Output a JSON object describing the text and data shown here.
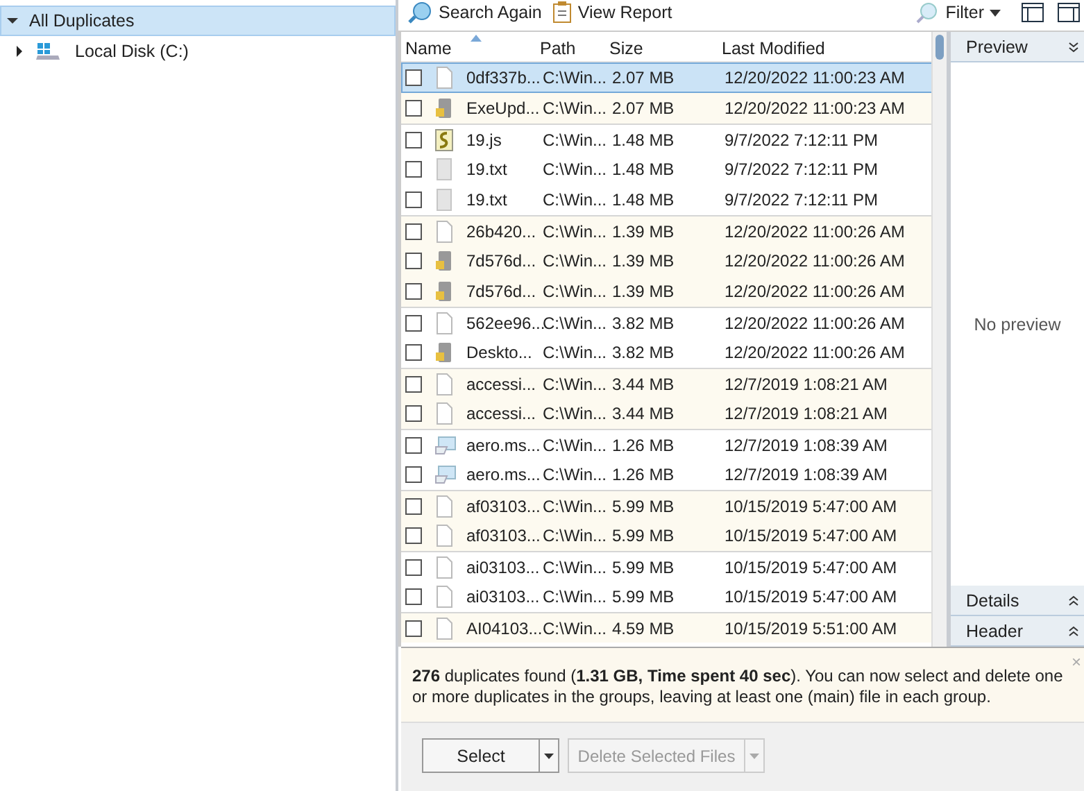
{
  "tree": [
    {
      "label": "All Duplicates",
      "expanded": true,
      "selected": true,
      "children": [
        {
          "label": "Local Disk (C:)",
          "expanded": false,
          "selected": false,
          "kind": "drive"
        }
      ]
    }
  ],
  "toolbar": [
    {
      "label": "Search Again",
      "kind": "search"
    },
    {
      "label": "View Report",
      "kind": "report"
    }
  ],
  "filter": {
    "label": "Filter"
  },
  "columns": [
    "Name",
    "Path",
    "Size",
    "Last Modified"
  ],
  "groups": [
    {
      "rows": [
        {
          "name": "0df337b...",
          "path": "C:\\Win...",
          "size": "2.07 MB",
          "modified": "12/20/2022 11:00:23 AM",
          "kind": "blank",
          "checked": false,
          "selected": true
        },
        {
          "name": "ExeUpd...",
          "path": "C:\\Win...",
          "size": "2.07 MB",
          "modified": "12/20/2022 11:00:23 AM",
          "kind": "exe",
          "checked": false,
          "selected": false
        }
      ]
    },
    {
      "rows": [
        {
          "name": "19.js",
          "path": "C:\\Win...",
          "size": "1.48 MB",
          "modified": "9/7/2022 7:12:11 PM",
          "kind": "script",
          "checked": false,
          "selected": false
        },
        {
          "name": "19.txt",
          "path": "C:\\Win...",
          "size": "1.48 MB",
          "modified": "9/7/2022 7:12:11 PM",
          "kind": "text",
          "checked": false,
          "selected": false
        },
        {
          "name": "19.txt",
          "path": "C:\\Win...",
          "size": "1.48 MB",
          "modified": "9/7/2022 7:12:11 PM",
          "kind": "text",
          "checked": false,
          "selected": false
        }
      ]
    },
    {
      "rows": [
        {
          "name": "26b420...",
          "path": "C:\\Win...",
          "size": "1.39 MB",
          "modified": "12/20/2022 11:00:26 AM",
          "kind": "blank",
          "checked": false,
          "selected": false
        },
        {
          "name": "7d576d...",
          "path": "C:\\Win...",
          "size": "1.39 MB",
          "modified": "12/20/2022 11:00:26 AM",
          "kind": "exe",
          "checked": false,
          "selected": false
        },
        {
          "name": "7d576d...",
          "path": "C:\\Win...",
          "size": "1.39 MB",
          "modified": "12/20/2022 11:00:26 AM",
          "kind": "exe",
          "checked": false,
          "selected": false
        }
      ]
    },
    {
      "rows": [
        {
          "name": "562ee96...",
          "path": "C:\\Win...",
          "size": "3.82 MB",
          "modified": "12/20/2022 11:00:26 AM",
          "kind": "blank",
          "checked": false,
          "selected": false
        },
        {
          "name": "Deskto...",
          "path": "C:\\Win...",
          "size": "3.82 MB",
          "modified": "12/20/2022 11:00:26 AM",
          "kind": "exe",
          "checked": false,
          "selected": false
        }
      ]
    },
    {
      "rows": [
        {
          "name": "accessi...",
          "path": "C:\\Win...",
          "size": "3.44 MB",
          "modified": "12/7/2019 1:08:21 AM",
          "kind": "blank",
          "checked": false,
          "selected": false
        },
        {
          "name": "accessi...",
          "path": "C:\\Win...",
          "size": "3.44 MB",
          "modified": "12/7/2019 1:08:21 AM",
          "kind": "blank",
          "checked": false,
          "selected": false
        }
      ]
    },
    {
      "rows": [
        {
          "name": "aero.ms...",
          "path": "C:\\Win...",
          "size": "1.26 MB",
          "modified": "12/7/2019 1:08:39 AM",
          "kind": "image",
          "checked": false,
          "selected": false
        },
        {
          "name": "aero.ms...",
          "path": "C:\\Win...",
          "size": "1.26 MB",
          "modified": "12/7/2019 1:08:39 AM",
          "kind": "image",
          "checked": false,
          "selected": false
        }
      ]
    },
    {
      "rows": [
        {
          "name": "af03103...",
          "path": "C:\\Win...",
          "size": "5.99 MB",
          "modified": "10/15/2019 5:47:00 AM",
          "kind": "blank",
          "checked": false,
          "selected": false
        },
        {
          "name": "af03103...",
          "path": "C:\\Win...",
          "size": "5.99 MB",
          "modified": "10/15/2019 5:47:00 AM",
          "kind": "blank",
          "checked": false,
          "selected": false
        }
      ]
    },
    {
      "rows": [
        {
          "name": "ai03103...",
          "path": "C:\\Win...",
          "size": "5.99 MB",
          "modified": "10/15/2019 5:47:00 AM",
          "kind": "blank",
          "checked": false,
          "selected": false
        },
        {
          "name": "ai03103...",
          "path": "C:\\Win...",
          "size": "5.99 MB",
          "modified": "10/15/2019 5:47:00 AM",
          "kind": "blank",
          "checked": false,
          "selected": false
        }
      ]
    },
    {
      "rows": [
        {
          "name": "AI04103...",
          "path": "C:\\Win...",
          "size": "4.59 MB",
          "modified": "10/15/2019 5:51:00 AM",
          "kind": "blank",
          "checked": false,
          "selected": false
        }
      ]
    }
  ],
  "panels": [
    {
      "title": "Preview",
      "expanded": true,
      "body": "No preview"
    },
    {
      "title": "Details",
      "expanded": false
    },
    {
      "title": "Header",
      "expanded": false
    }
  ],
  "message": {
    "text": "**276** duplicates found (**1.31 GB, Time spent 40 sec**). You can now select and delete one or more duplicates in the groups, leaving at least one (main) file in each group.",
    "close": "×"
  },
  "buttons": [
    {
      "label": "Select",
      "disabled": false
    },
    {
      "label": "Delete Selected Files",
      "disabled": true
    }
  ]
}
